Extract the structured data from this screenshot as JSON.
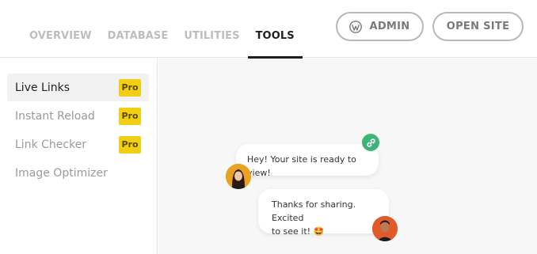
{
  "tabs": [
    {
      "label": "OVERVIEW",
      "active": false
    },
    {
      "label": "DATABASE",
      "active": false
    },
    {
      "label": "UTILITIES",
      "active": false
    },
    {
      "label": "TOOLS",
      "active": true
    }
  ],
  "header_buttons": {
    "admin_label": "ADMIN",
    "admin_icon": "wordpress-icon",
    "open_site_label": "OPEN SITE"
  },
  "sidebar": {
    "items": [
      {
        "label": "Live Links",
        "badge": "Pro",
        "active": true
      },
      {
        "label": "Instant Reload",
        "badge": "Pro",
        "active": false
      },
      {
        "label": "Link Checker",
        "badge": "Pro",
        "active": false
      },
      {
        "label": "Image Optimizer",
        "badge": "",
        "active": false
      }
    ]
  },
  "preview": {
    "message_1": "Hey! Your site is ready to view!",
    "message_2_line_1": "Thanks for sharing. Excited",
    "message_2_line_2": "to see it! 🤩",
    "link_icon": "link-icon"
  },
  "colors": {
    "accent_dark": "#1f1f1f",
    "pro_badge": "#f2cf14",
    "link_badge": "#3fb37a",
    "inactive_tab": "#bdbdbd",
    "preview_bg": "#f7f7f7"
  }
}
